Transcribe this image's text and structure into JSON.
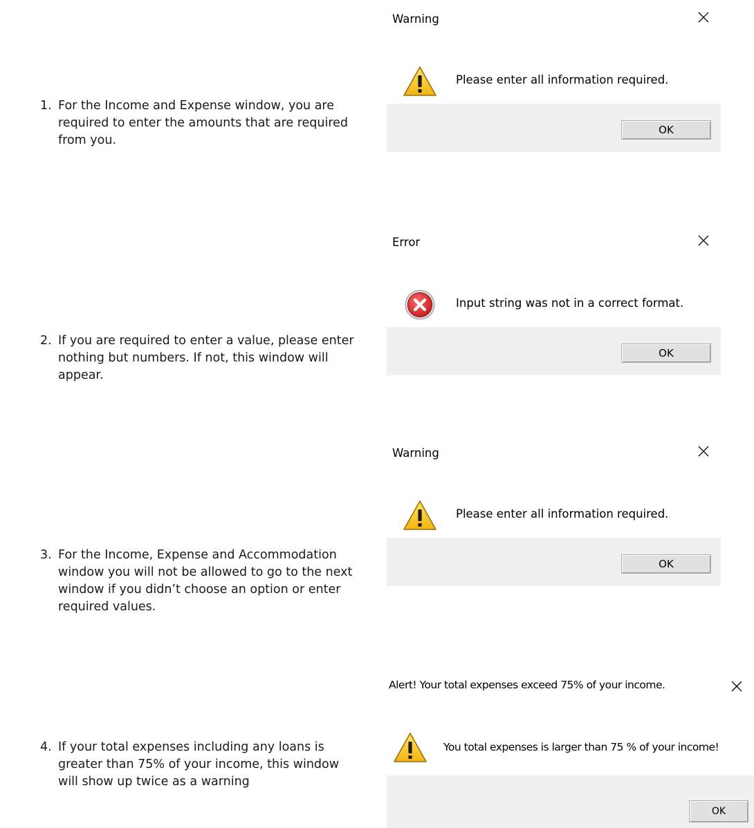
{
  "steps": [
    {
      "number": "1.",
      "text": "For the Income and Expense window, you are required to enter the amounts that are required from you."
    },
    {
      "number": "2.",
      "text": "If you are required to enter a value, please enter nothing but numbers. If not, this window will appear."
    },
    {
      "number": "3.",
      "text": "For the Income, Expense and Accommodation window you will not be allowed to go to the next window if you didn’t choose an option or enter required values."
    },
    {
      "number": "4.",
      "text": "If your total expenses including any loans is greater than 75% of your income, this window will show up twice as a warning"
    }
  ],
  "dialogs": [
    {
      "title": "Warning",
      "icon": "warning-icon",
      "message": "Please enter all information required.",
      "button": "OK"
    },
    {
      "title": "Error",
      "icon": "error-icon",
      "message": "Input string was not in a correct format.",
      "button": "OK"
    },
    {
      "title": "Warning",
      "icon": "warning-icon",
      "message": "Please enter all information required.",
      "button": "OK"
    },
    {
      "title": "Alert! Your total expenses exceed 75% of your income.",
      "icon": "warning-icon",
      "message": "You total expenses is larger than 75 % of your income!",
      "button": "OK"
    }
  ],
  "colors": {
    "footer": "#f0f0f0",
    "warning_yellow": "#f7c21a",
    "error_red": "#d9252b",
    "button_face": "#e1e1e1"
  }
}
